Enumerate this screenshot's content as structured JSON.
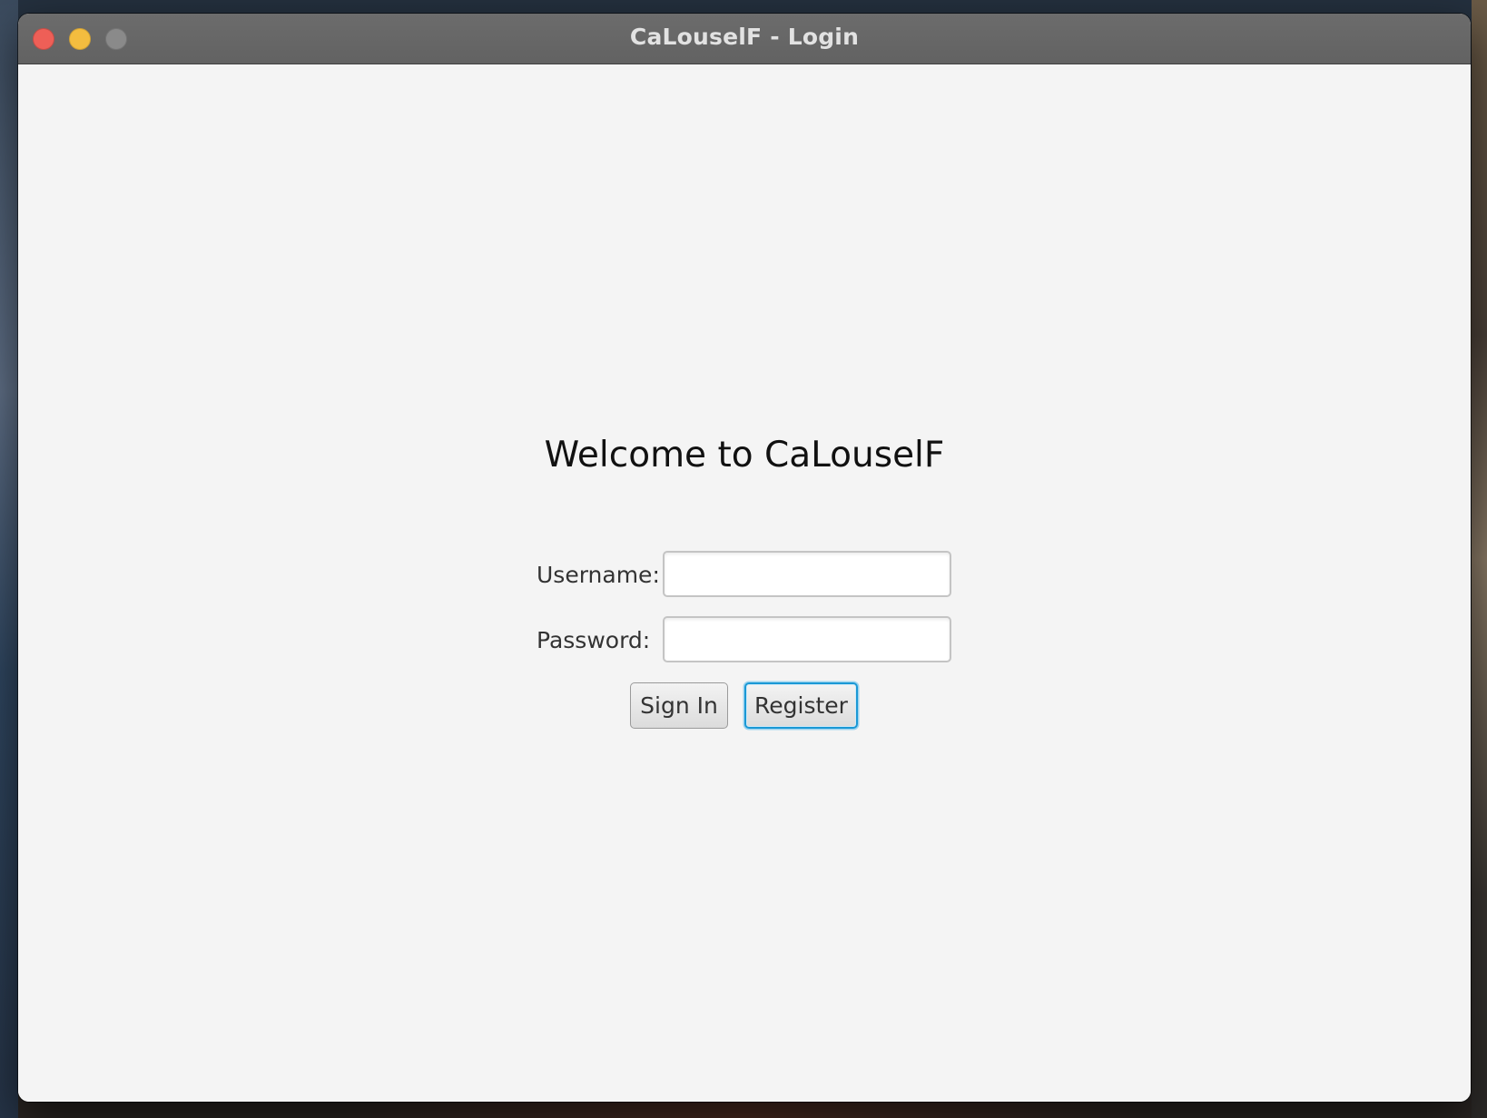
{
  "window": {
    "title": "CaLouselF - Login"
  },
  "traffic_lights": {
    "close_color": "#ee5f57",
    "minimize_color": "#f4bd3f",
    "zoom_color": "#8a8a8a"
  },
  "login": {
    "heading": "Welcome to CaLouselF",
    "username_label": "Username:",
    "username_value": "",
    "password_label": "Password:",
    "password_value": "",
    "sign_in_label": "Sign In",
    "register_label": "Register",
    "focused_button": "register",
    "focus_color": "#1a98d5"
  }
}
